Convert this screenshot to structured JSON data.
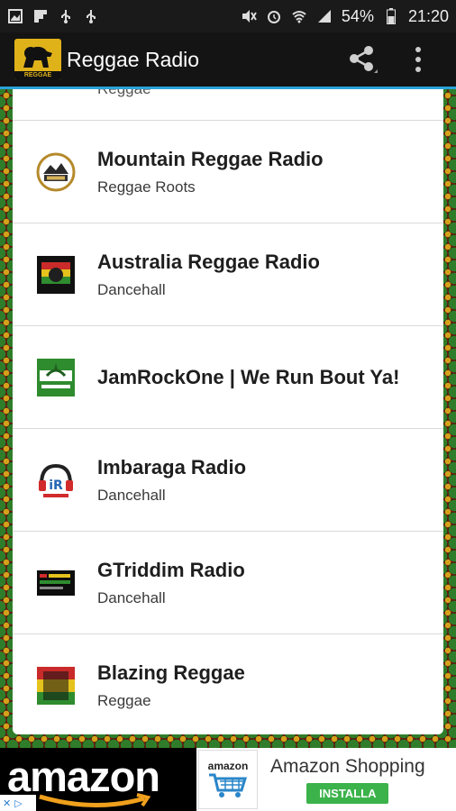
{
  "status_bar": {
    "battery": "54%",
    "time": "21:20"
  },
  "app": {
    "title": "Reggae Radio",
    "logo_text": "REGGAE RADIO"
  },
  "list": {
    "partial_item": "Reggae",
    "stations": [
      {
        "name": "Mountain Reggae Radio",
        "genre": "Reggae Roots",
        "icon": "mountain-reggae-logo"
      },
      {
        "name": "Australia Reggae Radio",
        "genre": "Dancehall",
        "icon": "australia-reggae-logo"
      },
      {
        "name": "JamRockOne | We Run Bout Ya!",
        "genre": "",
        "icon": "jamrockone-logo"
      },
      {
        "name": "Imbaraga Radio",
        "genre": "Dancehall",
        "icon": "imbaraga-logo"
      },
      {
        "name": "GTriddim Radio",
        "genre": "Dancehall",
        "icon": "gtriddim-logo"
      },
      {
        "name": "Blazing Reggae",
        "genre": "Reggae",
        "icon": "blazing-reggae-logo"
      }
    ]
  },
  "ad": {
    "brand": "amazon",
    "app_icon_text": "amazon",
    "title": "Amazon Shopping",
    "install": "INSTALLA"
  },
  "colors": {
    "action_bar": "#141414",
    "accent": "#2aa3d8",
    "install_green": "#3bb24a"
  }
}
